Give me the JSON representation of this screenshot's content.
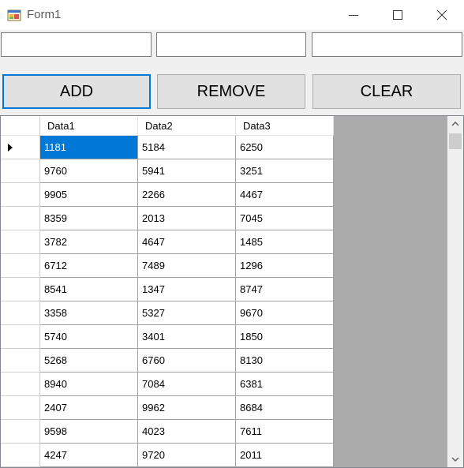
{
  "window": {
    "title": "Form1",
    "minimize_icon": "minimize-icon",
    "maximize_icon": "maximize-icon",
    "close_icon": "close-icon",
    "app_icon": "form-app-icon"
  },
  "inputs": [
    {
      "value": "",
      "placeholder": ""
    },
    {
      "value": "",
      "placeholder": ""
    },
    {
      "value": "",
      "placeholder": ""
    }
  ],
  "buttons": {
    "add": "ADD",
    "remove": "REMOVE",
    "clear": "CLEAR"
  },
  "grid": {
    "columns": [
      "Data1",
      "Data2",
      "Data3"
    ],
    "current_row_icon": "current-row-arrow-icon",
    "selected_cell": {
      "row": 0,
      "col": 0
    },
    "rows": [
      [
        "1181",
        "5184",
        "6250"
      ],
      [
        "9760",
        "5941",
        "3251"
      ],
      [
        "9905",
        "2266",
        "4467"
      ],
      [
        "8359",
        "2013",
        "7045"
      ],
      [
        "3782",
        "4647",
        "1485"
      ],
      [
        "6712",
        "7489",
        "1296"
      ],
      [
        "8541",
        "1347",
        "8747"
      ],
      [
        "3358",
        "5327",
        "9670"
      ],
      [
        "5740",
        "3401",
        "1850"
      ],
      [
        "5268",
        "6760",
        "8130"
      ],
      [
        "8940",
        "7084",
        "6381"
      ],
      [
        "2407",
        "9962",
        "8684"
      ],
      [
        "9598",
        "4023",
        "7611"
      ],
      [
        "4247",
        "9720",
        "2011"
      ]
    ]
  },
  "colors": {
    "selection": "#0078d7",
    "grid_background": "#ababab",
    "button_face": "#e1e1e1",
    "focus_border": "#0078d7"
  }
}
